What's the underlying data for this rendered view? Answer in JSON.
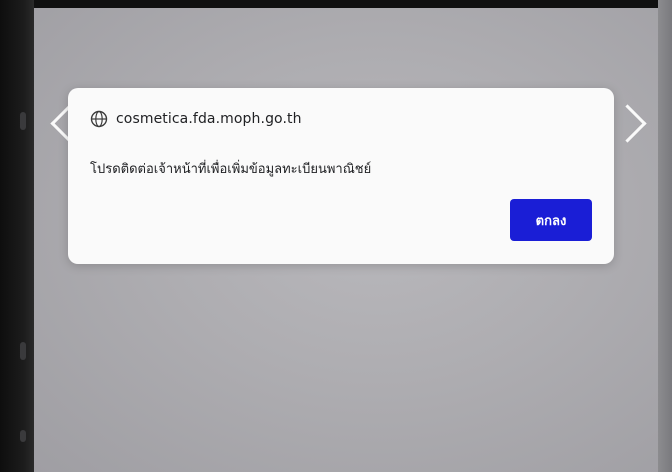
{
  "dialog": {
    "origin": "cosmetica.fda.moph.go.th",
    "message": "โปรดติดต่อเจ้าหน้าที่เพื่อเพิ่มข้อมูลทะเบียนพาณิชย์",
    "ok_label": "ตกลง",
    "icon": "globe-icon"
  },
  "colors": {
    "accent": "#1a1ed6",
    "dialog_bg": "#fafafa",
    "backdrop": "#aeadb1"
  }
}
